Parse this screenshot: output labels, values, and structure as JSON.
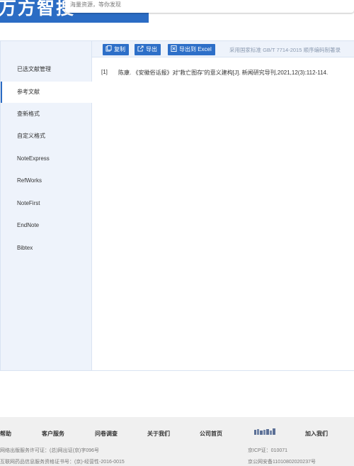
{
  "header": {
    "logo_text": "万方智搜",
    "search_placeholder": "海量资源，等你发现"
  },
  "toolbar": {
    "copy_label": "复制",
    "export_label": "导出",
    "export_excel_label": "导出到 Excel",
    "standard_note": "采用国家标准 GB/T 7714-2015 顺序编码制著录"
  },
  "sidebar": {
    "items": [
      {
        "label": "已选文献管理"
      },
      {
        "label": "参考文献"
      },
      {
        "label": "查新格式"
      },
      {
        "label": "自定义格式"
      },
      {
        "label": "NoteExpress"
      },
      {
        "label": "RefWorks"
      },
      {
        "label": "NoteFirst"
      },
      {
        "label": "EndNote"
      },
      {
        "label": "Bibtex"
      }
    ],
    "active_index": 1
  },
  "references": [
    {
      "index": "[1]",
      "text": "陈康. 《安徽俗话报》对“救亡图存”的意义建构[J]. 新闻研究导刊,2021,12(3):112-114."
    }
  ],
  "footer": {
    "nav": [
      "帮助",
      "客户服务",
      "问卷调查",
      "关于我们",
      "公司首页",
      "加入我们"
    ],
    "line1_left": "网络出版服务许可证：(总)网出证(京)字096号",
    "line1_right": "京ICP证：010071",
    "line2_left": "互联网药品信息服务资格证书号：(京)-经营性-2016-0015",
    "line2_right": "京公网安备11010802020237号"
  },
  "colors": {
    "brand_blue": "#2b6cc4",
    "button_blue": "#2d6fc8",
    "panel_bg": "#eef3fb",
    "footer_bg": "#f0f0f0"
  }
}
